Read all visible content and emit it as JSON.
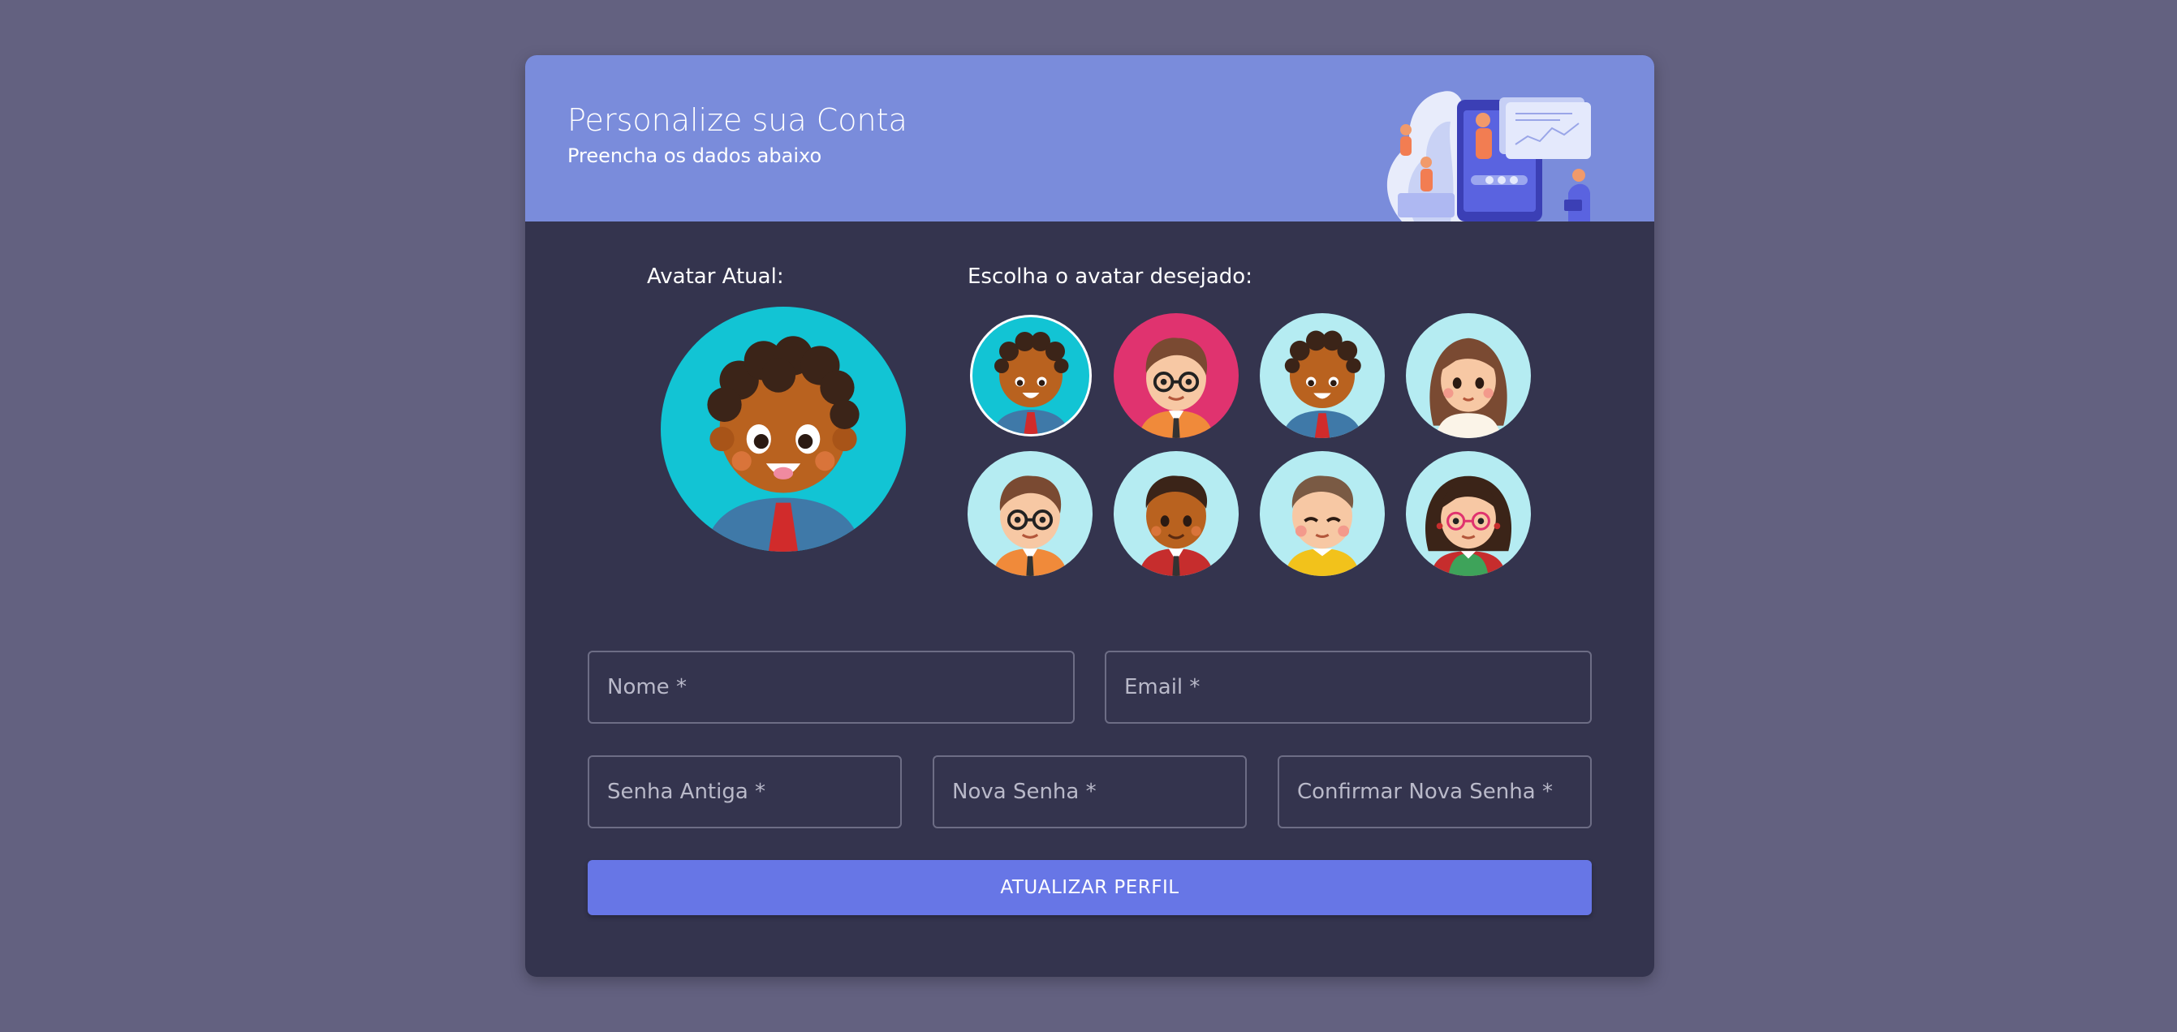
{
  "header": {
    "title": "Personalize sua Conta",
    "subtitle": "Preencha os dados abaixo",
    "illustration": "people-with-phone-dashboard-illustration"
  },
  "current_avatar": {
    "label": "Avatar Atual:",
    "avatar": "curly-hair-boy-avatar"
  },
  "avatar_picker": {
    "label": "Escolha o avatar desejado:",
    "options": [
      "curly-hair-boy-avatar",
      "glasses-boy-pink-avatar",
      "curly-hair-boy-light-avatar",
      "long-hair-girl-avatar",
      "glasses-man-avatar",
      "dark-hair-boy-avatar",
      "smiling-boy-avatar",
      "glasses-girl-avatar"
    ]
  },
  "form": {
    "name_placeholder": "Nome *",
    "email_placeholder": "Email *",
    "old_password_placeholder": "Senha Antiga *",
    "new_password_placeholder": "Nova Senha *",
    "confirm_password_placeholder": "Confirmar Nova Senha *",
    "submit_label": "ATUALIZAR PERFIL"
  },
  "colors": {
    "page_background": "#636180",
    "card_background": "#34344e",
    "header_background": "#7a8cdb",
    "button_background": "#6776e6"
  }
}
